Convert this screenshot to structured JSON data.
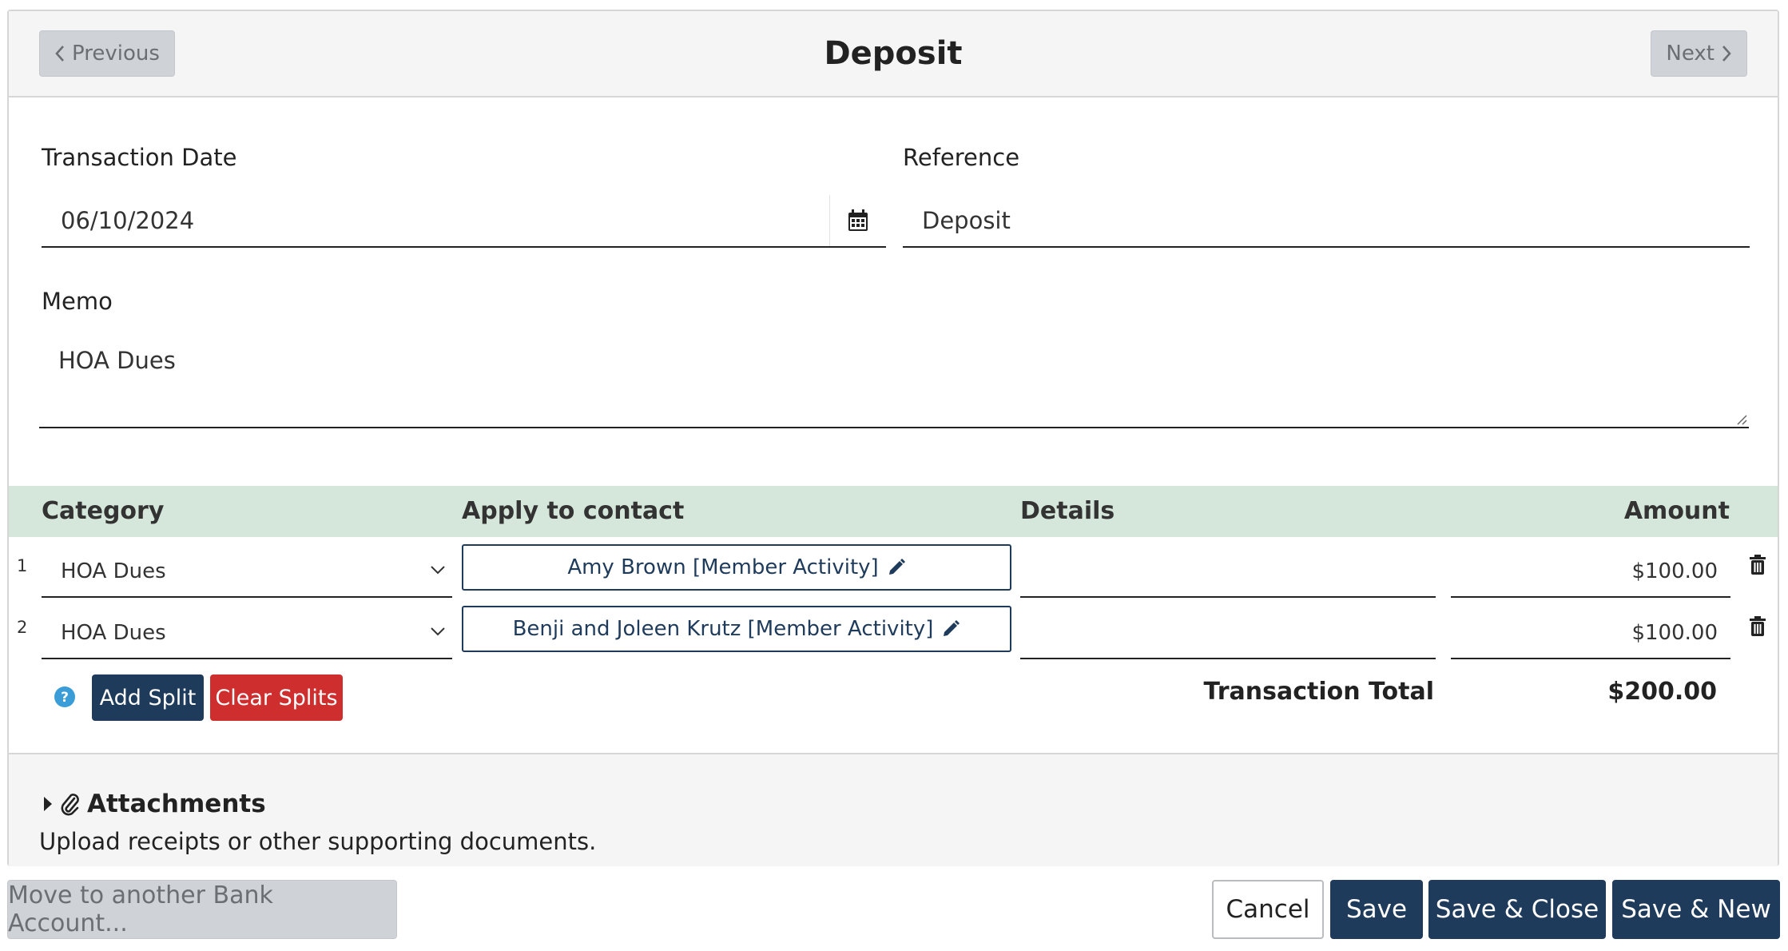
{
  "header": {
    "title": "Deposit",
    "previous_label": "Previous",
    "next_label": "Next"
  },
  "form": {
    "transaction_date_label": "Transaction Date",
    "transaction_date_value": "06/10/2024",
    "reference_label": "Reference",
    "reference_value": "Deposit",
    "memo_label": "Memo",
    "memo_value": "HOA Dues"
  },
  "splits": {
    "headers": {
      "category": "Category",
      "apply_to_contact": "Apply to contact",
      "details": "Details",
      "amount": "Amount"
    },
    "rows": [
      {
        "num": "1",
        "category": "HOA Dues",
        "contact": "Amy Brown [Member Activity]",
        "details": "",
        "amount": "$100.00"
      },
      {
        "num": "2",
        "category": "HOA Dues",
        "contact": "Benji and Joleen Krutz [Member Activity]",
        "details": "",
        "amount": "$100.00"
      }
    ],
    "add_split_label": "Add Split",
    "clear_splits_label": "Clear Splits",
    "total_label": "Transaction Total",
    "total_value": "$200.00"
  },
  "attachments": {
    "title": "Attachments",
    "description": "Upload receipts or other supporting documents."
  },
  "footer": {
    "move_label": "Move to another Bank Account...",
    "cancel_label": "Cancel",
    "save_label": "Save",
    "save_close_label": "Save & Close",
    "save_new_label": "Save & New"
  },
  "colors": {
    "primary": "#1f3b5c",
    "danger": "#cf2e2e",
    "table_header_bg": "#d5e7da",
    "disabled_bg": "#cfd2d6"
  }
}
